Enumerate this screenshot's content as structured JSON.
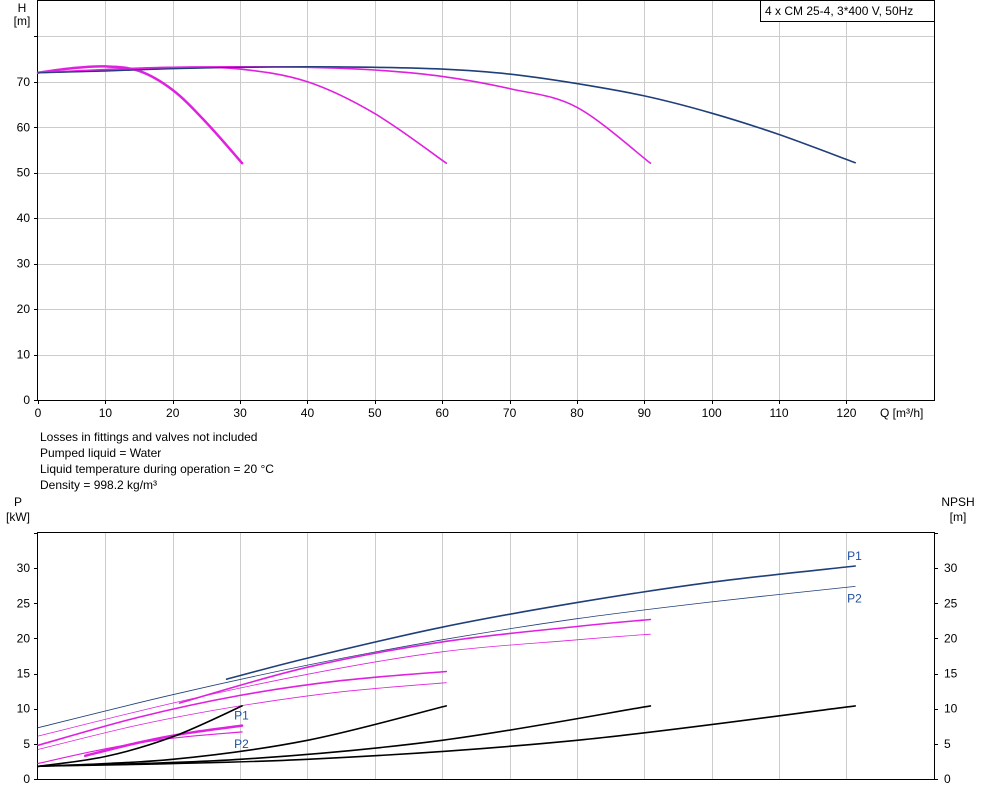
{
  "pump_label": "4 x CM 25-4, 3*400 V, 50Hz",
  "notes": [
    "Losses in fittings and valves not included",
    "Pumped liquid = Water",
    "Liquid temperature during operation = 20 °C",
    "Density = 998.2 kg/m³"
  ],
  "colors": {
    "blue": "#1f3f7a",
    "magenta": "#e020e0",
    "black": "#000000",
    "label_blue": "#1f4fa0"
  },
  "chart_data": [
    {
      "type": "line",
      "name": "head",
      "ylabel_lines": [
        "H",
        "[m]"
      ],
      "xlabel": "Q [m³/h]",
      "xlim": [
        0,
        133
      ],
      "ylim": [
        0,
        88
      ],
      "xticks": [
        0,
        10,
        20,
        30,
        40,
        50,
        60,
        70,
        80,
        90,
        100,
        110,
        120
      ],
      "yticks": [
        0,
        10,
        20,
        30,
        40,
        50,
        60,
        70
      ],
      "grid": true,
      "series": [
        {
          "color": "blue",
          "width": 1.6,
          "x": [
            0,
            10,
            20,
            30,
            40,
            50,
            60,
            70,
            80,
            90,
            100,
            110,
            121.3
          ],
          "y": [
            72,
            72.4,
            72.9,
            73.2,
            73.3,
            73.2,
            72.8,
            71.7,
            69.6,
            66.9,
            63.1,
            58.4,
            52.2
          ]
        },
        {
          "color": "magenta",
          "width": 1.6,
          "x": [
            0,
            10,
            20,
            30,
            40,
            50,
            60,
            70,
            80,
            90.9
          ],
          "y": [
            72,
            72.6,
            73.2,
            73.3,
            73.2,
            72.6,
            71.2,
            68.5,
            64.4,
            52.1
          ]
        },
        {
          "color": "magenta",
          "width": 1.6,
          "x": [
            0,
            10,
            20,
            30,
            40,
            50,
            60.6
          ],
          "y": [
            72,
            72.7,
            73.2,
            72.8,
            70.0,
            63.0,
            52.1
          ]
        },
        {
          "color": "magenta",
          "width": 2.5,
          "x": [
            0,
            5,
            10,
            15,
            20,
            25,
            30.3
          ],
          "y": [
            72,
            73.0,
            73.4,
            72.4,
            68.2,
            61.0,
            52.1
          ]
        },
        {
          "color": "blue",
          "width": 1,
          "x": [
            0,
            10,
            20,
            30,
            40,
            50
          ],
          "y": [
            72,
            72.4,
            72.9,
            73.2,
            73.3,
            73.2
          ]
        }
      ]
    },
    {
      "type": "line",
      "name": "power-npsh",
      "ylabel_lines": [
        "P",
        "[kW]"
      ],
      "y2label_lines": [
        "NPSH",
        "[m]"
      ],
      "xlim": [
        0,
        133
      ],
      "ylim": [
        0,
        35
      ],
      "y2lim": [
        0,
        35
      ],
      "yticks": [
        0,
        5,
        10,
        15,
        20,
        25,
        30
      ],
      "y2ticks": [
        0,
        5,
        10,
        15,
        20,
        25,
        30
      ],
      "grid": true,
      "series": [
        {
          "color": "blue",
          "width": 1.6,
          "x": [
            28,
            40,
            60,
            80,
            100,
            121.3
          ],
          "y": [
            14.2,
            17.2,
            21.6,
            25.1,
            28.0,
            30.3
          ],
          "label": "P1"
        },
        {
          "color": "blue",
          "width": 0.8,
          "x": [
            0,
            20,
            40,
            60,
            80,
            100,
            121.3
          ],
          "y": [
            7.3,
            12.0,
            16.2,
            19.8,
            22.8,
            25.2,
            27.4
          ],
          "label": "P2"
        },
        {
          "color": "magenta",
          "width": 1.6,
          "x": [
            21,
            40,
            60,
            80,
            90.9
          ],
          "y": [
            10.8,
            15.9,
            19.5,
            21.7,
            22.7
          ]
        },
        {
          "color": "magenta",
          "width": 0.8,
          "x": [
            0,
            20,
            40,
            60,
            80,
            90.9
          ],
          "y": [
            6.1,
            10.8,
            14.9,
            18.1,
            19.8,
            20.6
          ]
        },
        {
          "color": "magenta",
          "width": 1.6,
          "x": [
            0,
            15,
            30,
            45,
            60.6
          ],
          "y": [
            4.8,
            8.8,
            11.9,
            14.0,
            15.3
          ]
        },
        {
          "color": "magenta",
          "width": 0.8,
          "x": [
            0,
            15,
            30,
            45,
            60.6
          ],
          "y": [
            4.2,
            7.7,
            10.4,
            12.4,
            13.7
          ]
        },
        {
          "color": "magenta",
          "width": 2.5,
          "x": [
            7,
            15,
            22,
            30.3
          ],
          "y": [
            3.3,
            5.2,
            6.5,
            7.6
          ],
          "label": "P1"
        },
        {
          "color": "magenta",
          "width": 1.2,
          "x": [
            0,
            10,
            20,
            30.3
          ],
          "y": [
            2.2,
            4.3,
            5.8,
            6.7
          ],
          "label": "P2"
        },
        {
          "color": "black",
          "width": 1.6,
          "x": [
            0,
            10,
            20,
            30.3
          ],
          "y": [
            1.8,
            3.2,
            6.0,
            10.4
          ]
        },
        {
          "color": "black",
          "width": 1.6,
          "x": [
            0,
            20,
            40,
            60.6
          ],
          "y": [
            1.8,
            2.8,
            5.5,
            10.4
          ]
        },
        {
          "color": "black",
          "width": 1.6,
          "x": [
            0,
            30,
            60,
            90.9
          ],
          "y": [
            1.8,
            2.8,
            5.5,
            10.4
          ]
        },
        {
          "color": "black",
          "width": 1.6,
          "x": [
            0,
            40,
            80,
            121.3
          ],
          "y": [
            1.8,
            2.8,
            5.5,
            10.4
          ]
        }
      ]
    }
  ]
}
